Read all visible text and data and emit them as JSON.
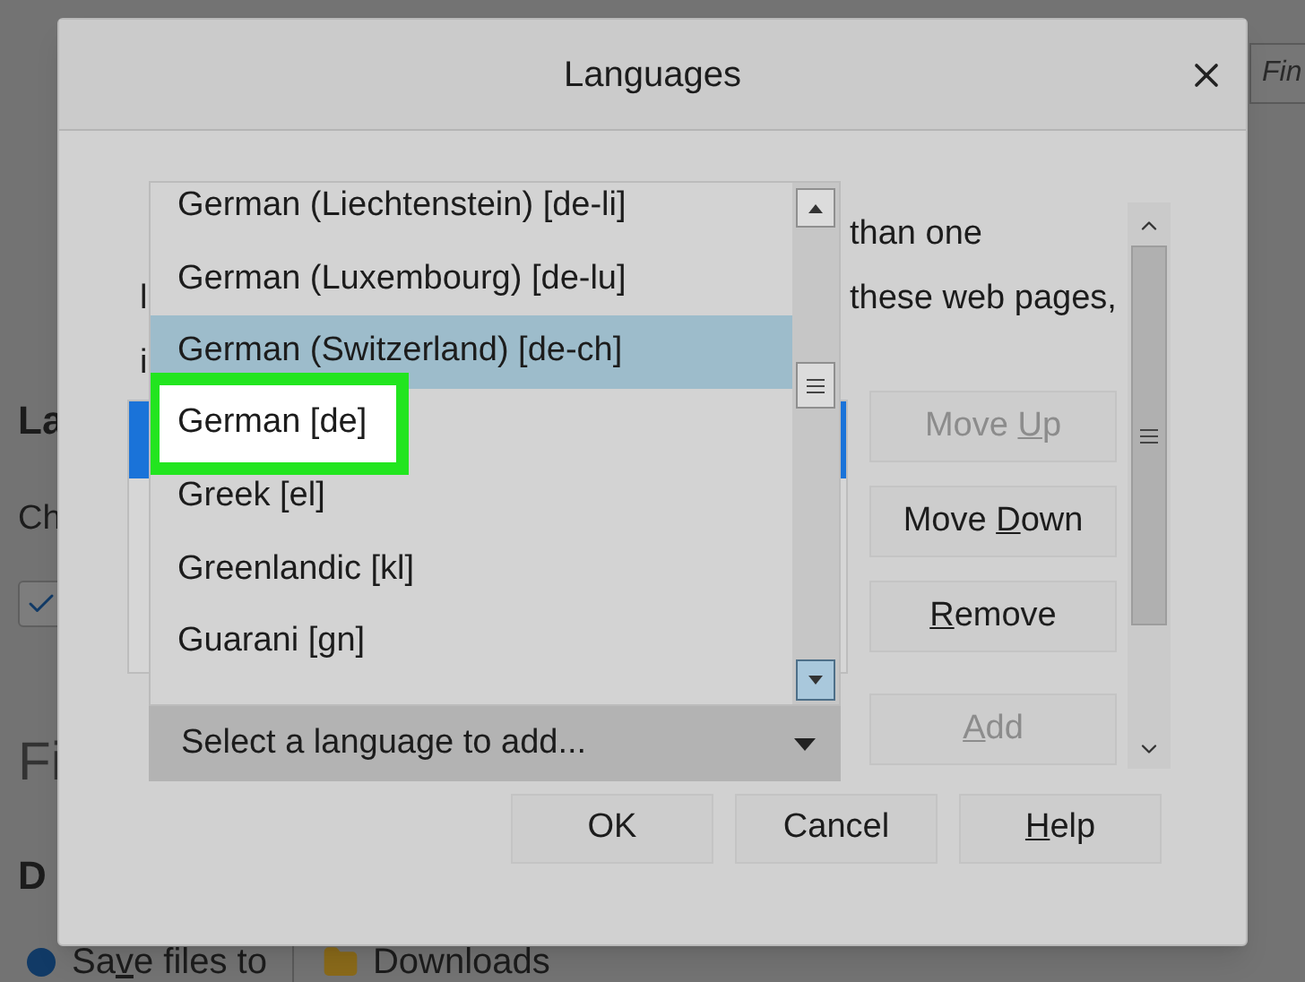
{
  "page": {
    "search_field": {
      "placeholder": "Fin"
    },
    "section_heading": "La",
    "section_text": "Ch",
    "checkbox": {
      "checked": true
    },
    "fonts_heading": "Fi",
    "downloads_heading": "D",
    "download_option": {
      "label": {
        "before": "Sa",
        "key": "v",
        "after": "e files to"
      },
      "selected": true
    },
    "download_folder": "Downloads"
  },
  "dialog": {
    "title": "Languages",
    "description_lines": [
      {
        "end": "than one"
      },
      {
        "start": "l",
        "end": "these web pages,"
      },
      {
        "start": "i"
      }
    ],
    "selected_languages": [
      {
        "selected": true
      }
    ],
    "side_buttons": [
      {
        "label": {
          "before": "Move ",
          "key": "U",
          "after": "p"
        },
        "disabled": true
      },
      {
        "label": {
          "before": "Move ",
          "key": "D",
          "after": "own"
        },
        "disabled": false
      },
      {
        "label": {
          "key": "R",
          "after": "emove"
        },
        "disabled": false
      },
      {
        "label": {
          "key": "A",
          "after": "dd"
        },
        "disabled": true
      }
    ],
    "language_select": {
      "value": "Select a language to add..."
    },
    "dropdown_items": [
      {
        "label": "German (Liechtenstein) [de-li]",
        "selected": false,
        "highlighted": false
      },
      {
        "label": "German (Luxembourg) [de-lu]",
        "selected": false,
        "highlighted": false
      },
      {
        "label": "German (Switzerland) [de-ch]",
        "selected": true,
        "highlighted": false
      },
      {
        "label": "German [de]",
        "selected": false,
        "highlighted": true
      },
      {
        "label": "Greek [el]",
        "selected": false,
        "highlighted": false
      },
      {
        "label": "Greenlandic [kl]",
        "selected": false,
        "highlighted": false
      },
      {
        "label": "Guarani [gn]",
        "selected": false,
        "highlighted": false
      }
    ],
    "footer_buttons": [
      {
        "label": {
          "before": "OK"
        }
      },
      {
        "label": {
          "before": "Cancel"
        }
      },
      {
        "label": {
          "key": "H",
          "after": "elp"
        }
      }
    ]
  }
}
